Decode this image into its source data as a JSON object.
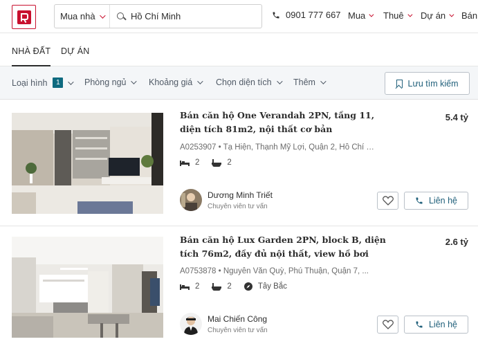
{
  "header": {
    "search_mode": "Mua nhà",
    "search_value": "Hồ Chí Minh",
    "phone": "0901 777 667",
    "nav": [
      {
        "label": "Mua"
      },
      {
        "label": "Thuê"
      },
      {
        "label": "Dự án"
      },
      {
        "label": "Bán"
      }
    ]
  },
  "tabs": [
    {
      "label": "NHÀ ĐẤT",
      "active": true
    },
    {
      "label": "DỰ ÁN",
      "active": false
    }
  ],
  "filters": {
    "items": [
      {
        "label": "Loại hình",
        "badge": "1"
      },
      {
        "label": "Phòng ngủ"
      },
      {
        "label": "Khoảng giá"
      },
      {
        "label": "Chọn diện tích"
      },
      {
        "label": "Thêm"
      }
    ],
    "save_search": "Lưu tìm kiếm"
  },
  "listings": [
    {
      "title": "Bán căn hộ One Verandah 2PN, tầng 11, diện tích 81m2, nội thất cơ bản",
      "price": "5.4 tỷ",
      "address": "A0253907 • Tạ Hiện, Thạnh Mỹ Lợi, Quận 2, Hồ Chí Minh",
      "bedrooms": "2",
      "bathrooms": "2",
      "agent_name": "Dương Minh Triết",
      "agent_role": "Chuyên viên tư vấn",
      "contact": "Liên hệ"
    },
    {
      "title": "Bán căn hộ Lux Garden 2PN, block B, diện tích 76m2, đầy đủ nội thất, view hồ bơi",
      "price": "2.6 tỷ",
      "address": "A0753878 • Nguyễn Văn Quỳ, Phú Thuận, Quận 7, ...",
      "bedrooms": "2",
      "bathrooms": "2",
      "direction": "Tây Bắc",
      "agent_name": "Mai Chiến Công",
      "agent_role": "Chuyên viên tư vấn",
      "contact": "Liên hệ"
    }
  ],
  "colors": {
    "brand_red": "#c8102e",
    "accent_teal": "#1f5f7a",
    "badge": "#0e6a7f"
  }
}
